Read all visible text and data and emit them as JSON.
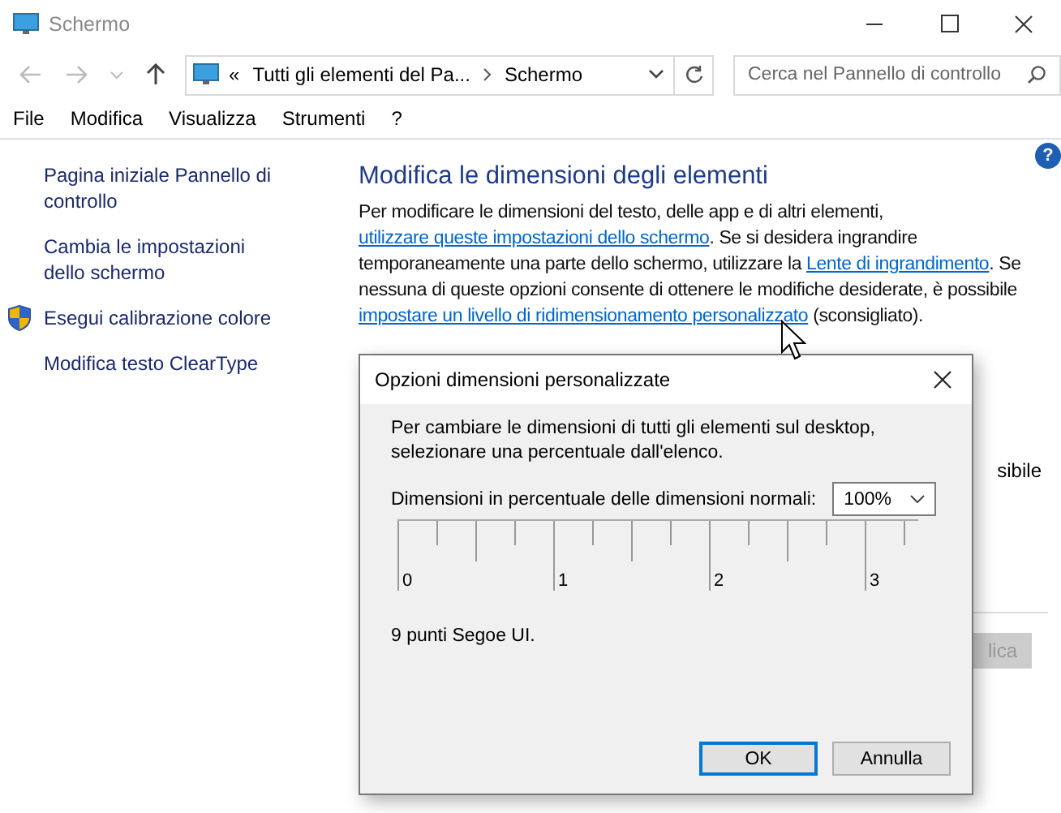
{
  "window": {
    "title": "Schermo"
  },
  "address": {
    "prefix": "«",
    "crumbs": [
      "Tutti gli elementi del Pa...",
      "Schermo"
    ]
  },
  "search": {
    "placeholder": "Cerca nel Pannello di controllo"
  },
  "menu": [
    "File",
    "Modifica",
    "Visualizza",
    "Strumenti",
    "?"
  ],
  "help": "?",
  "sidebar": [
    {
      "label": "Pagina iniziale Pannello di controllo",
      "kind": "plain"
    },
    {
      "label": "Cambia le impostazioni dello schermo",
      "kind": "plain"
    },
    {
      "label": "Esegui calibrazione colore",
      "kind": "shield"
    },
    {
      "label": "Modifica testo ClearType",
      "kind": "plain"
    }
  ],
  "heading": "Modifica le dimensioni degli elementi",
  "paragraph": [
    {
      "kind": "text",
      "text": "Per modificare le dimensioni del testo, delle app e di altri elementi, "
    },
    {
      "kind": "link",
      "text": "utilizzare queste impostazioni dello schermo"
    },
    {
      "kind": "text",
      "text": ". Se si desidera ingrandire temporaneamente una parte dello schermo, utilizzare la "
    },
    {
      "kind": "link",
      "text": "Lente di ingrandimento"
    },
    {
      "kind": "text",
      "text": ". Se nessuna di queste opzioni consente di ottenere le modifiche desiderate, è possibile "
    },
    {
      "kind": "link",
      "text": "impostare un livello di ridimensionamento personalizzato"
    },
    {
      "kind": "text",
      "text": " (sconsigliato)."
    }
  ],
  "partial_text": "sibile",
  "apply_button": {
    "label": "lica",
    "disabled": true
  },
  "dialog": {
    "title": "Opzioni dimensioni personalizzate",
    "description": "Per cambiare le dimensioni di tutti gli elementi sul desktop, selezionare una percentuale dall'elenco.",
    "scale_label": "Dimensioni in percentuale delle dimensioni normali:",
    "scale_value": "100%",
    "ruler_labels": [
      "0",
      "1",
      "2",
      "3"
    ],
    "font_note": "9 punti Segoe UI.",
    "buttons": [
      {
        "label": "OK",
        "selected": true
      },
      {
        "label": "Annulla",
        "selected": false
      }
    ]
  }
}
